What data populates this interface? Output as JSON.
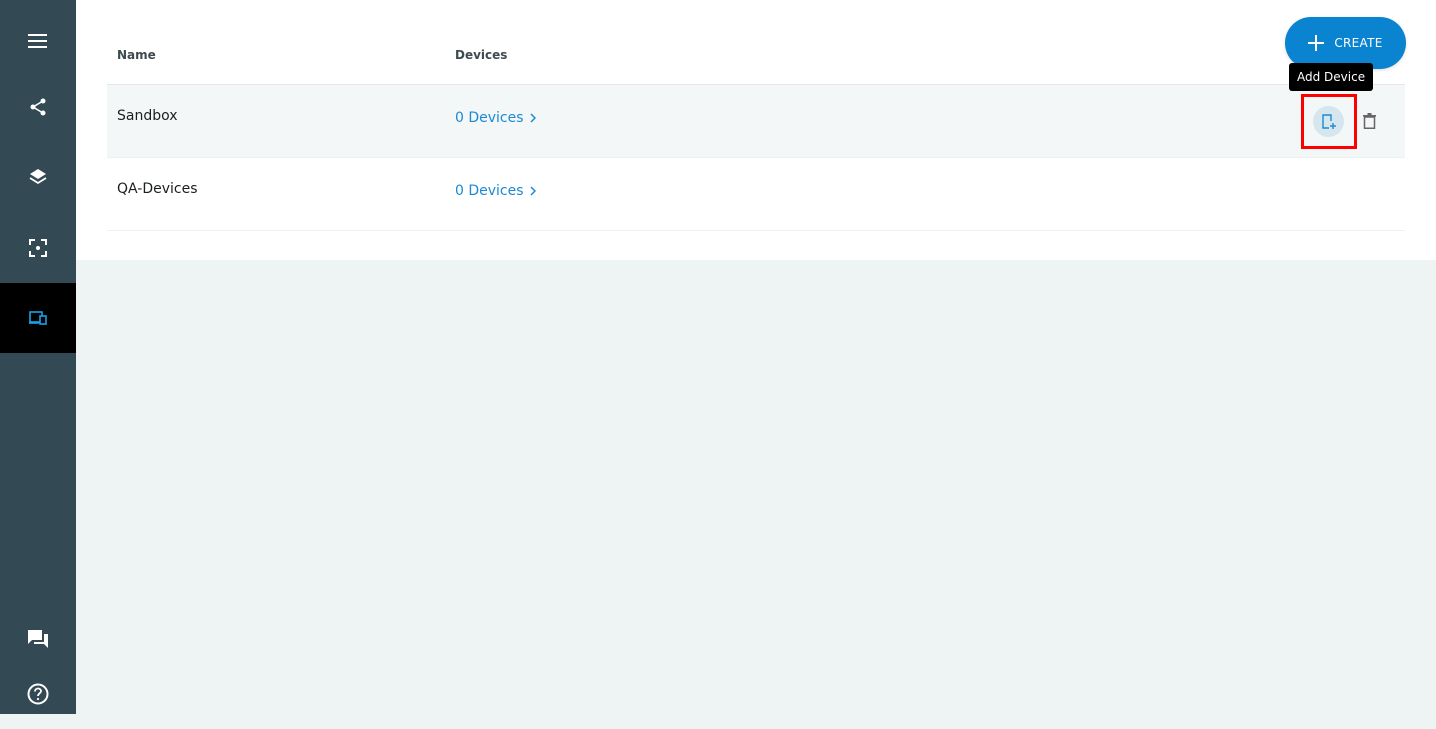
{
  "sidebar": {
    "items": [
      {
        "icon": "menu-icon"
      },
      {
        "icon": "share-nodes-icon"
      },
      {
        "icon": "layers-icon"
      },
      {
        "icon": "scan-frame-icon"
      },
      {
        "icon": "devices-icon",
        "active": true
      },
      {
        "icon": "chat-icon"
      },
      {
        "icon": "help-icon"
      }
    ]
  },
  "header": {
    "create_label": "CREATE",
    "tooltip": "Add Device"
  },
  "table": {
    "columns": [
      "Name",
      "Devices"
    ],
    "rows": [
      {
        "name": "Sandbox",
        "devices": "0 Devices"
      },
      {
        "name": "QA-Devices",
        "devices": "0 Devices"
      }
    ]
  },
  "colors": {
    "sidebar": "#334a54",
    "accent": "#0a83d1",
    "link": "#1a8ad4",
    "active_icon": "#1aa3e8",
    "highlight": "#ff0000"
  }
}
